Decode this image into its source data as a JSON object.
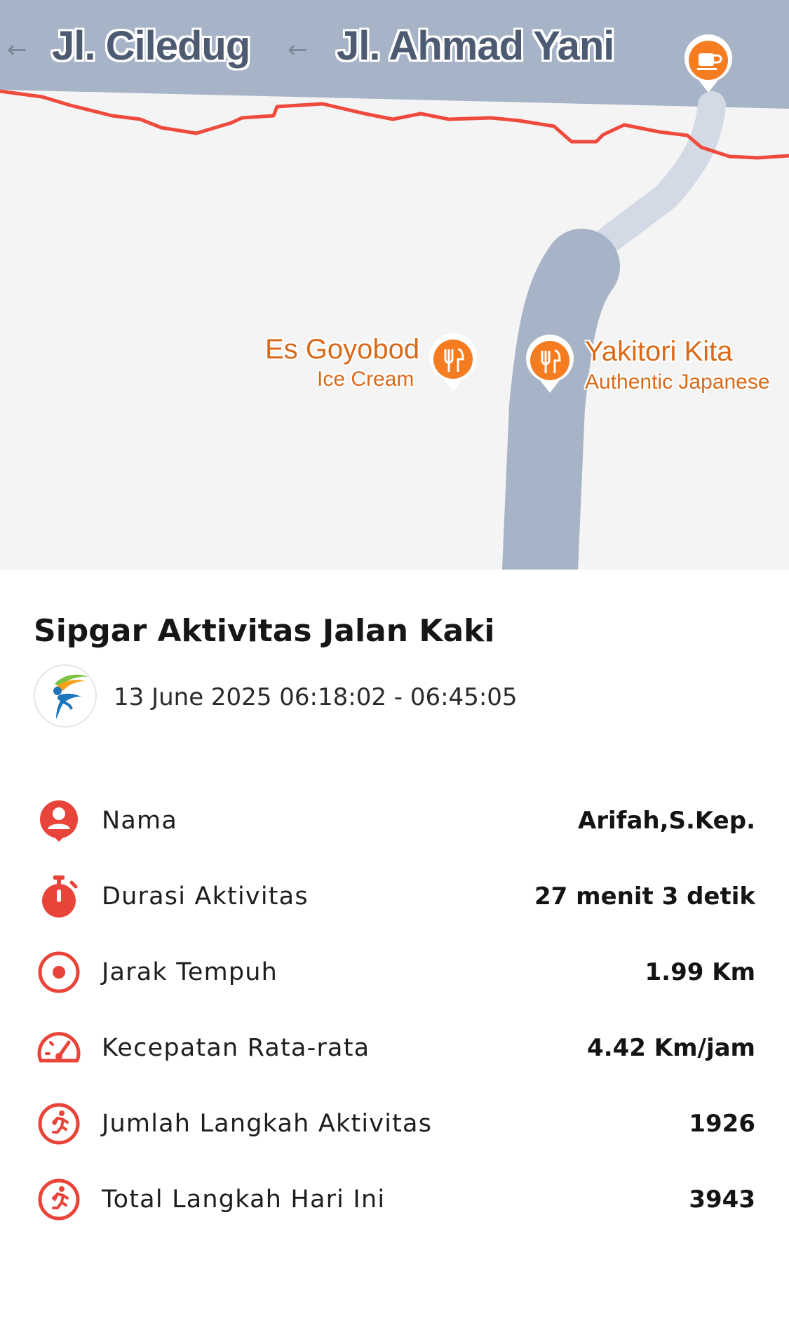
{
  "map": {
    "roads": [
      {
        "name": "Jl. Ciledug"
      },
      {
        "name": "Jl. Ahmad Yani"
      }
    ],
    "pois": [
      {
        "name": "Es Goyobod",
        "category": "Ice Cream",
        "icon": "restaurant-icon"
      },
      {
        "name": "Yakitori Kita",
        "category": "Authentic Japanese",
        "icon": "restaurant-icon"
      },
      {
        "name": "",
        "category": "",
        "icon": "cafe-icon"
      }
    ],
    "colors": {
      "route": "#ef4a3c",
      "major_road": "#a7b3c6",
      "minor_road": "#d3dae5",
      "poi": "#f57c20",
      "background": "#f4f4f5"
    }
  },
  "card": {
    "title": "Sipgar Aktivitas Jalan Kaki",
    "date_range": "13 June 2025 06:18:02 - 06:45:05",
    "accent": "#e8443a",
    "stats": [
      {
        "icon": "user-pin-icon",
        "label": "Nama",
        "value": "Arifah,S.Kep."
      },
      {
        "icon": "stopwatch-icon",
        "label": "Durasi Aktivitas",
        "value": "27 menit 3 detik"
      },
      {
        "icon": "target-icon",
        "label": "Jarak Tempuh",
        "value": "1.99 Km"
      },
      {
        "icon": "speedometer-icon",
        "label": "Kecepatan Rata-rata",
        "value": "4.42 Km/jam"
      },
      {
        "icon": "runner-icon",
        "label": "Jumlah Langkah Aktivitas",
        "value": "1926"
      },
      {
        "icon": "runner-icon",
        "label": "Total Langkah Hari Ini",
        "value": "3943"
      }
    ]
  }
}
